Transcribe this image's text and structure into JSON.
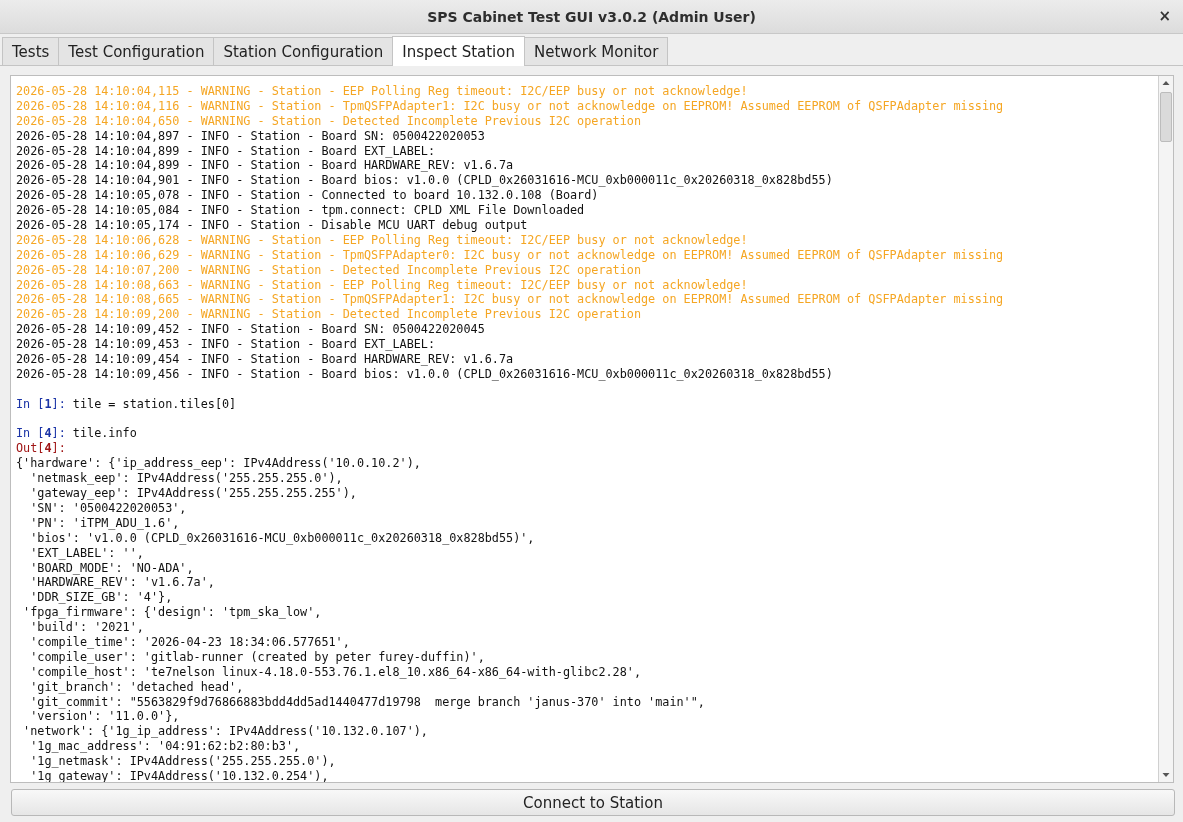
{
  "window": {
    "title": "SPS Cabinet Test GUI v3.0.2 (Admin User)",
    "close": "×"
  },
  "tabs": [
    {
      "label": "Tests",
      "selected": false
    },
    {
      "label": "Test Configuration",
      "selected": false
    },
    {
      "label": "Station Configuration",
      "selected": false
    },
    {
      "label": "Inspect Station",
      "selected": true
    },
    {
      "label": "Network Monitor",
      "selected": false
    }
  ],
  "console": {
    "lines": [
      {
        "kind": "warning",
        "text": "2026-05-28 14:10:04,115 - WARNING - Station - EEP Polling Reg timeout: I2C/EEP busy or not acknowledge!"
      },
      {
        "kind": "warning",
        "text": "2026-05-28 14:10:04,116 - WARNING - Station - TpmQSFPAdapter1: I2C busy or not acknowledge on EEPROM! Assumed EEPROM of QSFPAdapter missing"
      },
      {
        "kind": "warning",
        "text": "2026-05-28 14:10:04,650 - WARNING - Station - Detected Incomplete Previous I2C operation"
      },
      {
        "kind": "info",
        "text": "2026-05-28 14:10:04,897 - INFO - Station - Board SN: 0500422020053"
      },
      {
        "kind": "info",
        "text": "2026-05-28 14:10:04,899 - INFO - Station - Board EXT_LABEL:"
      },
      {
        "kind": "info",
        "text": "2026-05-28 14:10:04,899 - INFO - Station - Board HARDWARE_REV: v1.6.7a"
      },
      {
        "kind": "info",
        "text": "2026-05-28 14:10:04,901 - INFO - Station - Board bios: v1.0.0 (CPLD_0x26031616-MCU_0xb000011c_0x20260318_0x828bd55)"
      },
      {
        "kind": "info",
        "text": "2026-05-28 14:10:05,078 - INFO - Station - Connected to board 10.132.0.108 (Board)"
      },
      {
        "kind": "info",
        "text": "2026-05-28 14:10:05,084 - INFO - Station - tpm.connect: CPLD XML File Downloaded"
      },
      {
        "kind": "info",
        "text": "2026-05-28 14:10:05,174 - INFO - Station - Disable MCU UART debug output"
      },
      {
        "kind": "warning",
        "text": "2026-05-28 14:10:06,628 - WARNING - Station - EEP Polling Reg timeout: I2C/EEP busy or not acknowledge!"
      },
      {
        "kind": "warning",
        "text": "2026-05-28 14:10:06,629 - WARNING - Station - TpmQSFPAdapter0: I2C busy or not acknowledge on EEPROM! Assumed EEPROM of QSFPAdapter missing"
      },
      {
        "kind": "warning",
        "text": "2026-05-28 14:10:07,200 - WARNING - Station - Detected Incomplete Previous I2C operation"
      },
      {
        "kind": "warning",
        "text": "2026-05-28 14:10:08,663 - WARNING - Station - EEP Polling Reg timeout: I2C/EEP busy or not acknowledge!"
      },
      {
        "kind": "warning",
        "text": "2026-05-28 14:10:08,665 - WARNING - Station - TpmQSFPAdapter1: I2C busy or not acknowledge on EEPROM! Assumed EEPROM of QSFPAdapter missing"
      },
      {
        "kind": "warning",
        "text": "2026-05-28 14:10:09,200 - WARNING - Station - Detected Incomplete Previous I2C operation"
      },
      {
        "kind": "info",
        "text": "2026-05-28 14:10:09,452 - INFO - Station - Board SN: 0500422020045"
      },
      {
        "kind": "info",
        "text": "2026-05-28 14:10:09,453 - INFO - Station - Board EXT_LABEL:"
      },
      {
        "kind": "info",
        "text": "2026-05-28 14:10:09,454 - INFO - Station - Board HARDWARE_REV: v1.6.7a"
      },
      {
        "kind": "info",
        "text": "2026-05-28 14:10:09,456 - INFO - Station - Board bios: v1.0.0 (CPLD_0x26031616-MCU_0xb000011c_0x20260318_0x828bd55)"
      },
      {
        "kind": "blank"
      },
      {
        "kind": "input",
        "prompt": "In [**1**]:",
        "code": "tile = station.tiles[0]"
      },
      {
        "kind": "blank"
      },
      {
        "kind": "input",
        "prompt": "In [**4**]:",
        "code": "tile.info"
      },
      {
        "kind": "out",
        "prompt": "Out[**4**]:"
      },
      {
        "kind": "output",
        "text": "{'hardware': {'ip_address_eep': IPv4Address('10.0.10.2'),"
      },
      {
        "kind": "output",
        "text": "  'netmask_eep': IPv4Address('255.255.255.0'),"
      },
      {
        "kind": "output",
        "text": "  'gateway_eep': IPv4Address('255.255.255.255'),"
      },
      {
        "kind": "output",
        "text": "  'SN': '0500422020053',"
      },
      {
        "kind": "output",
        "text": "  'PN': 'iTPM_ADU_1.6',"
      },
      {
        "kind": "output",
        "text": "  'bios': 'v1.0.0 (CPLD_0x26031616-MCU_0xb000011c_0x20260318_0x828bd55)',"
      },
      {
        "kind": "output",
        "text": "  'EXT_LABEL': '',"
      },
      {
        "kind": "output",
        "text": "  'BOARD_MODE': 'NO-ADA',"
      },
      {
        "kind": "output",
        "text": "  'HARDWARE_REV': 'v1.6.7a',"
      },
      {
        "kind": "output",
        "text": "  'DDR_SIZE_GB': '4'},"
      },
      {
        "kind": "output",
        "text": " 'fpga_firmware': {'design': 'tpm_ska_low',"
      },
      {
        "kind": "output",
        "text": "  'build': '2021',"
      },
      {
        "kind": "output",
        "text": "  'compile_time': '2026-04-23 18:34:06.577651',"
      },
      {
        "kind": "output",
        "text": "  'compile_user': 'gitlab-runner (created by peter furey-duffin)',"
      },
      {
        "kind": "output",
        "text": "  'compile_host': 'te7nelson linux-4.18.0-553.76.1.el8_10.x86_64-x86_64-with-glibc2.28',"
      },
      {
        "kind": "output",
        "text": "  'git_branch': 'detached head',"
      },
      {
        "kind": "output",
        "text": "  'git_commit': \"5563829f9d76866883bdd4dd5ad1440477d19798  merge branch 'janus-370' into 'main'\","
      },
      {
        "kind": "output",
        "text": "  'version': '11.0.0'},"
      },
      {
        "kind": "output",
        "text": " 'network': {'1g_ip_address': IPv4Address('10.132.0.107'),"
      },
      {
        "kind": "output",
        "text": "  '1g_mac_address': '04:91:62:b2:80:b3',"
      },
      {
        "kind": "output",
        "text": "  '1g_netmask': IPv4Address('255.255.255.0'),"
      },
      {
        "kind": "output",
        "text": "  '1g_gateway': IPv4Address('10.132.0.254'),"
      }
    ]
  },
  "connect_button": {
    "label": "Connect to Station"
  }
}
